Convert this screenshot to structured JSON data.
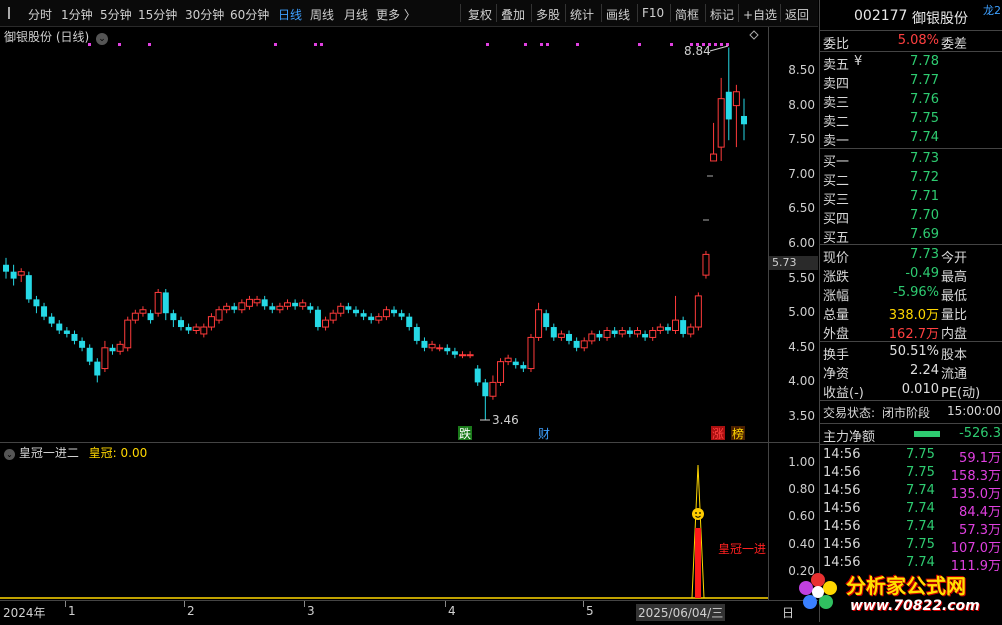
{
  "toolbar": {
    "left_items": [
      "分时",
      "1分钟",
      "5分钟",
      "15分钟",
      "30分钟",
      "60分钟",
      "日线",
      "周线",
      "月线",
      "更多 〉"
    ],
    "active": "日线",
    "right_items": [
      "复权",
      "叠加",
      "多股",
      "统计",
      "画线",
      "F10",
      "简框",
      "标记",
      "+自选",
      "返回"
    ]
  },
  "stock": {
    "code": "002177",
    "name": "御银股份",
    "title": "御银股份 (日线)",
    "period": "日线"
  },
  "price_axis": {
    "labels": [
      "8.50",
      "8.00",
      "7.50",
      "7.00",
      "6.50",
      "6.00",
      "5.50",
      "5.00",
      "4.50",
      "4.00",
      "3.50"
    ],
    "current": "5.73"
  },
  "annotations": {
    "high": "8.84",
    "low": "3.46",
    "markers": [
      "跌",
      "财",
      "涨",
      "榜"
    ]
  },
  "indicator": {
    "name": "皇冠一进二",
    "param_label": "皇冠:",
    "param_value": "0.00",
    "axis_labels": [
      "1.00",
      "0.80",
      "0.60",
      "0.40",
      "0.20"
    ],
    "signal_text": "皇冠一进"
  },
  "date_axis": {
    "labels": [
      "2024年",
      "1",
      "2",
      "3",
      "4",
      "5"
    ],
    "cursor_date": "2025/06/04/三",
    "right_label": "日"
  },
  "panel": {
    "code": "002177",
    "name": "御银股份",
    "corner": "龙2",
    "webi_label": "委比",
    "webi_value": "5.08%",
    "weicha_label": "委差",
    "asks": [
      {
        "label": "卖五",
        "mark": "¥",
        "price": "7.78"
      },
      {
        "label": "卖四",
        "mark": "",
        "price": "7.77"
      },
      {
        "label": "卖三",
        "mark": "",
        "price": "7.76"
      },
      {
        "label": "卖二",
        "mark": "",
        "price": "7.75"
      },
      {
        "label": "卖一",
        "mark": "",
        "price": "7.74"
      }
    ],
    "bids": [
      {
        "label": "买一",
        "price": "7.73"
      },
      {
        "label": "买二",
        "price": "7.72"
      },
      {
        "label": "买三",
        "price": "7.71"
      },
      {
        "label": "买四",
        "price": "7.70"
      },
      {
        "label": "买五",
        "price": "7.69"
      }
    ],
    "stats": [
      {
        "label": "现价",
        "value": "7.73",
        "color": "green",
        "label2": "今开"
      },
      {
        "label": "涨跌",
        "value": "-0.49",
        "color": "green",
        "label2": "最高"
      },
      {
        "label": "涨幅",
        "value": "-5.96%",
        "color": "green",
        "label2": "最低"
      },
      {
        "label": "总量",
        "value": "338.0万",
        "color": "yellow",
        "label2": "量比"
      },
      {
        "label": "外盘",
        "value": "162.7万",
        "color": "red",
        "label2": "内盘"
      }
    ],
    "stats2": [
      {
        "label": "换手",
        "value": "50.51%",
        "label2": "股本"
      },
      {
        "label": "净资",
        "value": "2.24",
        "label2": "流通"
      },
      {
        "label": "收益(-)",
        "value": "0.010",
        "label2": "PE(动)"
      }
    ],
    "trade_status_label": "交易状态:",
    "trade_status": "闭市阶段",
    "trade_time": "15:00:00",
    "main_net_label": "主力净额",
    "main_net_value": "-526.3",
    "ticks": [
      {
        "time": "14:56",
        "price": "7.75",
        "vol": "59.1万"
      },
      {
        "time": "14:56",
        "price": "7.75",
        "vol": "158.3万"
      },
      {
        "time": "14:56",
        "price": "7.74",
        "vol": "135.0万"
      },
      {
        "time": "14:56",
        "price": "7.74",
        "vol": "84.4万"
      },
      {
        "time": "14:56",
        "price": "7.74",
        "vol": "57.3万"
      },
      {
        "time": "14:56",
        "price": "7.75",
        "vol": "107.0万"
      },
      {
        "time": "14:56",
        "price": "7.74",
        "vol": "111.9万"
      }
    ]
  },
  "watermark": {
    "text": "分析家公式网",
    "url": "www.70822.com"
  },
  "chart_data": {
    "type": "candlestick",
    "ylim": [
      3.3,
      9.0
    ],
    "candles": [
      [
        5.7,
        5.6,
        5.8,
        5.5
      ],
      [
        5.6,
        5.5,
        5.7,
        5.4
      ],
      [
        5.55,
        5.6,
        5.65,
        5.45
      ],
      [
        5.55,
        5.2,
        5.6,
        5.15
      ],
      [
        5.2,
        5.1,
        5.25,
        5.0
      ],
      [
        5.1,
        4.95,
        5.15,
        4.9
      ],
      [
        4.95,
        4.85,
        5.0,
        4.8
      ],
      [
        4.85,
        4.75,
        4.9,
        4.7
      ],
      [
        4.75,
        4.7,
        4.8,
        4.65
      ],
      [
        4.7,
        4.6,
        4.75,
        4.55
      ],
      [
        4.6,
        4.5,
        4.65,
        4.45
      ],
      [
        4.5,
        4.3,
        4.55,
        4.25
      ],
      [
        4.3,
        4.1,
        4.35,
        4.0
      ],
      [
        4.2,
        4.5,
        4.6,
        4.15
      ],
      [
        4.5,
        4.45,
        4.55,
        4.4
      ],
      [
        4.45,
        4.55,
        4.6,
        4.4
      ],
      [
        4.5,
        4.9,
        4.95,
        4.45
      ],
      [
        4.9,
        5.0,
        5.05,
        4.85
      ],
      [
        5.0,
        5.05,
        5.1,
        4.95
      ],
      [
        5.0,
        4.9,
        5.05,
        4.85
      ],
      [
        5.0,
        5.3,
        5.35,
        4.95
      ],
      [
        5.3,
        5.0,
        5.35,
        4.9
      ],
      [
        5.0,
        4.9,
        5.05,
        4.8
      ],
      [
        4.9,
        4.8,
        4.95,
        4.75
      ],
      [
        4.8,
        4.75,
        4.85,
        4.7
      ],
      [
        4.75,
        4.8,
        4.85,
        4.7
      ],
      [
        4.7,
        4.8,
        4.85,
        4.65
      ],
      [
        4.8,
        4.95,
        5.0,
        4.75
      ],
      [
        4.9,
        5.05,
        5.1,
        4.85
      ],
      [
        5.05,
        5.1,
        5.15,
        5.0
      ],
      [
        5.1,
        5.05,
        5.15,
        5.0
      ],
      [
        5.05,
        5.15,
        5.2,
        5.0
      ],
      [
        5.1,
        5.2,
        5.25,
        5.05
      ],
      [
        5.15,
        5.2,
        5.25,
        5.1
      ],
      [
        5.2,
        5.1,
        5.25,
        5.05
      ],
      [
        5.1,
        5.05,
        5.15,
        5.0
      ],
      [
        5.05,
        5.1,
        5.15,
        5.0
      ],
      [
        5.1,
        5.15,
        5.2,
        5.05
      ],
      [
        5.15,
        5.1,
        5.2,
        5.05
      ],
      [
        5.1,
        5.15,
        5.2,
        5.05
      ],
      [
        5.1,
        5.05,
        5.15,
        5.0
      ],
      [
        5.05,
        4.8,
        5.1,
        4.75
      ],
      [
        4.8,
        4.9,
        4.95,
        4.75
      ],
      [
        4.9,
        5.0,
        5.05,
        4.85
      ],
      [
        5.0,
        5.1,
        5.15,
        4.95
      ],
      [
        5.1,
        5.05,
        5.15,
        5.0
      ],
      [
        5.05,
        5.0,
        5.1,
        4.95
      ],
      [
        5.0,
        4.95,
        5.05,
        4.9
      ],
      [
        4.95,
        4.9,
        5.0,
        4.85
      ],
      [
        4.9,
        4.95,
        5.0,
        4.85
      ],
      [
        4.95,
        5.05,
        5.1,
        4.9
      ],
      [
        5.05,
        5.0,
        5.1,
        4.95
      ],
      [
        5.0,
        4.95,
        5.05,
        4.9
      ],
      [
        4.95,
        4.8,
        5.0,
        4.75
      ],
      [
        4.8,
        4.6,
        4.85,
        4.55
      ],
      [
        4.6,
        4.5,
        4.65,
        4.45
      ],
      [
        4.5,
        4.55,
        4.6,
        4.45
      ],
      [
        4.5,
        4.5,
        4.55,
        4.45
      ],
      [
        4.5,
        4.45,
        4.55,
        4.4
      ],
      [
        4.45,
        4.4,
        4.5,
        4.35
      ],
      [
        4.4,
        4.4,
        4.45,
        4.35
      ],
      [
        4.4,
        4.4,
        4.45,
        4.35
      ],
      [
        4.2,
        4.0,
        4.25,
        3.95
      ],
      [
        4.0,
        3.8,
        4.05,
        3.46
      ],
      [
        3.8,
        4.0,
        4.1,
        3.75
      ],
      [
        4.0,
        4.3,
        4.35,
        3.95
      ],
      [
        4.3,
        4.35,
        4.4,
        4.25
      ],
      [
        4.3,
        4.25,
        4.35,
        4.2
      ],
      [
        4.25,
        4.2,
        4.3,
        4.15
      ],
      [
        4.2,
        4.65,
        4.7,
        4.15
      ],
      [
        4.65,
        5.05,
        5.15,
        4.6
      ],
      [
        5.0,
        4.8,
        5.05,
        4.75
      ],
      [
        4.8,
        4.65,
        4.85,
        4.6
      ],
      [
        4.65,
        4.7,
        4.75,
        4.6
      ],
      [
        4.7,
        4.6,
        4.75,
        4.55
      ],
      [
        4.6,
        4.5,
        4.65,
        4.45
      ],
      [
        4.5,
        4.6,
        4.65,
        4.45
      ],
      [
        4.6,
        4.7,
        4.75,
        4.55
      ],
      [
        4.7,
        4.65,
        4.75,
        4.6
      ],
      [
        4.65,
        4.75,
        4.8,
        4.6
      ],
      [
        4.75,
        4.7,
        4.8,
        4.65
      ],
      [
        4.7,
        4.75,
        4.8,
        4.65
      ],
      [
        4.75,
        4.7,
        4.8,
        4.65
      ],
      [
        4.7,
        4.75,
        4.8,
        4.65
      ],
      [
        4.7,
        4.65,
        4.75,
        4.6
      ],
      [
        4.65,
        4.75,
        4.8,
        4.6
      ],
      [
        4.75,
        4.8,
        4.85,
        4.7
      ],
      [
        4.8,
        4.75,
        4.85,
        4.7
      ],
      [
        4.75,
        4.9,
        5.25,
        4.7
      ],
      [
        4.9,
        4.7,
        4.95,
        4.65
      ],
      [
        4.7,
        4.8,
        4.85,
        4.65
      ],
      [
        4.8,
        5.25,
        5.3,
        4.75
      ],
      [
        5.55,
        5.85,
        5.9,
        5.5
      ],
      [
        7.2,
        7.3,
        7.75,
        7.2
      ],
      [
        7.4,
        8.1,
        8.4,
        7.2
      ],
      [
        8.2,
        7.8,
        8.84,
        7.5
      ],
      [
        8.0,
        8.2,
        8.3,
        7.4
      ],
      [
        7.85,
        7.73,
        8.1,
        7.5
      ]
    ]
  }
}
